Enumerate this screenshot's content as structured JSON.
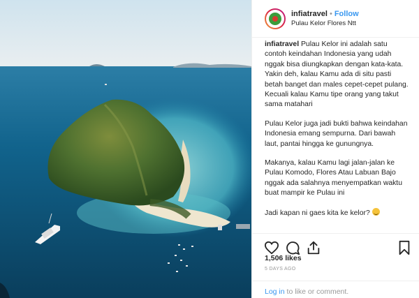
{
  "post": {
    "username": "infiatravel",
    "separator": "•",
    "follow_label": "Follow",
    "location": "Pulau Kelor Flores Ntt"
  },
  "caption": {
    "username": "infiatravel",
    "para1": "Pulau Kelor ini adalah satu contoh keindahan Indonesia yang udah nggak bisa diungkapkan dengan kata-kata. Yakin deh, kalau Kamu ada di situ pasti betah banget dan males cepet-cepet pulang. Kecuali kalau Kamu tipe orang yang takut sama matahari",
    "para2": "Pulau Kelor juga jadi bukti bahwa keindahan Indonesia emang sempurna. Dari bawah laut, pantai hingga ke gunungnya.",
    "para3": "Makanya, kalau Kamu lagi jalan-jalan ke Pulau Komodo, Flores Atau Labuan Bajo nggak ada salahnya menyempatkan waktu buat mampir ke Pulau ini",
    "para4": "Jadi kapan ni gaes kita ke kelor?",
    "emoji": "smiling-face-emoji",
    "dots": [
      ".",
      ".",
      "."
    ]
  },
  "actions": {
    "like_icon": "heart-icon",
    "comment_icon": "comment-icon",
    "share_icon": "share-icon",
    "save_icon": "bookmark-icon"
  },
  "stats": {
    "likes": "1,506 likes",
    "time_ago": "5 DAYS AGO"
  },
  "comment_bar": {
    "login_label": "Log in",
    "rest_text": " to like or comment."
  },
  "colors": {
    "link": "#3897f0",
    "text": "#262626",
    "muted": "#999999",
    "sea": "#0f5f86",
    "island": "#3f6a2a"
  }
}
